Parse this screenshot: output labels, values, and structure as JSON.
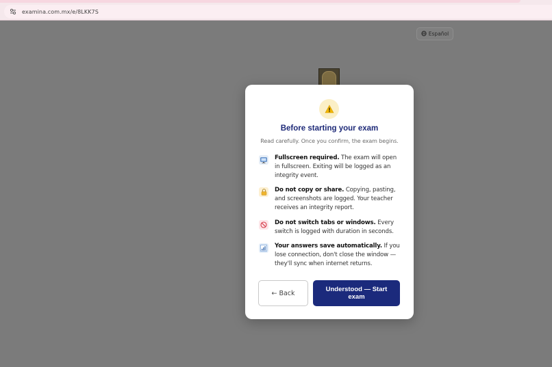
{
  "browser": {
    "url": "examina.com.mx/e/8LKK7S",
    "site_settings_icon": "tune-icon"
  },
  "page": {
    "language_button": "Español",
    "language_icon": "globe-icon",
    "crest_icon": "school-crest-icon"
  },
  "modal": {
    "warning_icon": "warning-icon",
    "title": "Before starting your exam",
    "subtitle": "Read carefully. Once you confirm, the exam begins.",
    "rules": [
      {
        "icon": "monitor-icon",
        "heading": "Fullscreen required.",
        "body": " The exam will open in fullscreen. Exiting will be logged as an integrity event."
      },
      {
        "icon": "lock-icon",
        "heading": "Do not copy or share.",
        "body": " Copying, pasting, and screenshots are logged. Your teacher receives an integrity report."
      },
      {
        "icon": "no-entry-icon",
        "heading": "Do not switch tabs or windows.",
        "body": " Every switch is logged with duration in seconds."
      },
      {
        "icon": "chart-icon",
        "heading": "Your answers save automatically.",
        "body": " If you lose connection, don't close the window — they'll sync when internet returns."
      }
    ],
    "back_label": "← Back",
    "start_label": "Understood — Start exam"
  },
  "colors": {
    "accent": "#1b2a7c",
    "title": "#1e2a78",
    "overlay": "#7b7b7b",
    "warning_bg": "#fbefc6"
  }
}
